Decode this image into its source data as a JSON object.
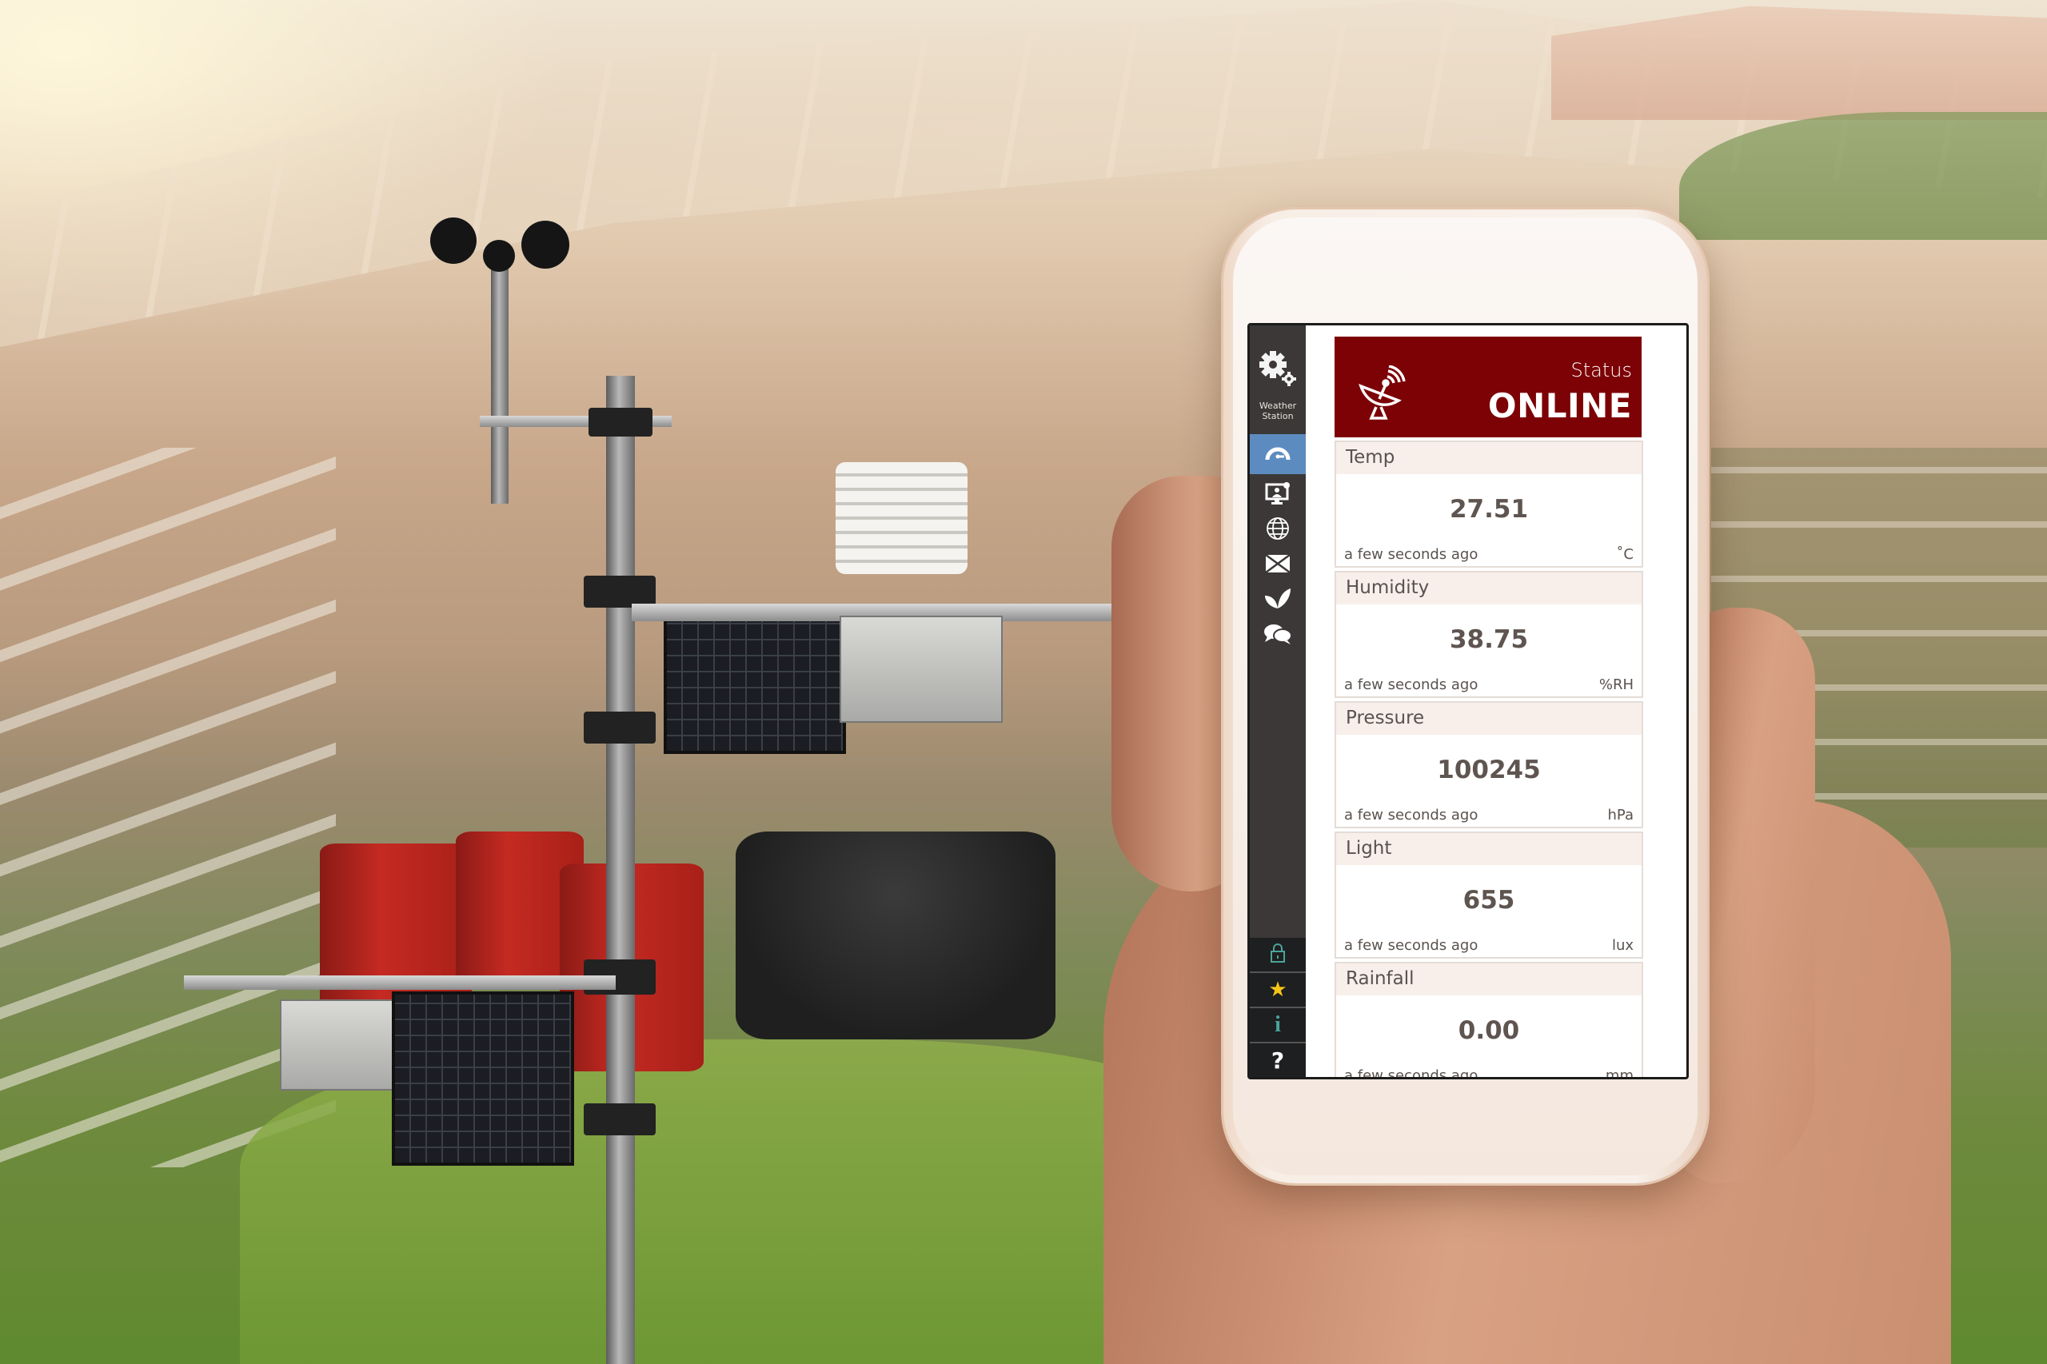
{
  "app": {
    "name": "Weather Station",
    "sidebar": {
      "brand_label": "Weather Station",
      "nav_items": [
        {
          "icon": "gears-icon",
          "label": "Settings"
        },
        {
          "icon": "gauge-icon",
          "label": "Dashboard",
          "active": true
        },
        {
          "icon": "monitor-user-icon",
          "label": "Monitor"
        },
        {
          "icon": "globe-icon",
          "label": "Web"
        },
        {
          "icon": "mail-icon",
          "label": "Mail"
        },
        {
          "icon": "leaf-icon",
          "label": "Plants"
        },
        {
          "icon": "chat-icon",
          "label": "Chat"
        }
      ],
      "bottom_items": [
        {
          "icon": "lock-icon",
          "glyph": "🔒"
        },
        {
          "icon": "star-icon",
          "glyph": "★"
        },
        {
          "icon": "info-icon",
          "glyph": "i"
        },
        {
          "icon": "help-icon",
          "glyph": "?"
        }
      ]
    },
    "status": {
      "label": "Status",
      "value": "ONLINE",
      "icon": "satellite-dish-icon",
      "color": "#7c0205"
    },
    "sensors": [
      {
        "name": "Temp",
        "value": "27.51",
        "updated": "a few seconds ago",
        "unit": "˚C"
      },
      {
        "name": "Humidity",
        "value": "38.75",
        "updated": "a few seconds ago",
        "unit": "%RH"
      },
      {
        "name": "Pressure",
        "value": "100245",
        "updated": "a few seconds ago",
        "unit": "hPa"
      },
      {
        "name": "Light",
        "value": "655",
        "updated": "a few seconds ago",
        "unit": "lux"
      },
      {
        "name": "Rainfall",
        "value": "0.00",
        "updated": "a few seconds ago",
        "unit": "mm"
      }
    ],
    "colors": {
      "sidebar": "#3b3837",
      "sidebar_active": "#5c8cbf",
      "sidebar_bottom": "#1e1f20",
      "card_header": "#f8efeb",
      "text": "#5a524e",
      "star": "#f5c518",
      "teal_icon": "#4aa39a"
    }
  }
}
